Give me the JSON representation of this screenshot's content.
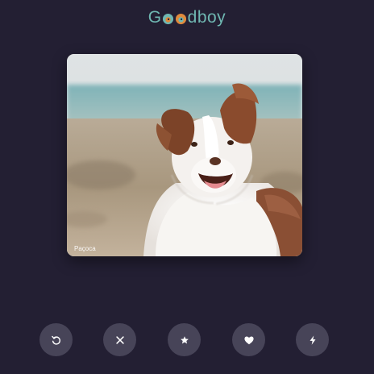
{
  "app": {
    "logo_prefix": "G",
    "logo_suffix": "dboy",
    "colors": {
      "background": "#231f33",
      "accent": "#6fb7b2",
      "button": "#474458"
    }
  },
  "card": {
    "name": "Paçoca",
    "image": "australian-shepherd-dog-on-beach"
  },
  "actions": [
    {
      "name": "undo",
      "icon": "undo-icon"
    },
    {
      "name": "nope",
      "icon": "close-icon"
    },
    {
      "name": "superlike",
      "icon": "star-icon"
    },
    {
      "name": "like",
      "icon": "heart-icon"
    },
    {
      "name": "boost",
      "icon": "bolt-icon"
    }
  ]
}
